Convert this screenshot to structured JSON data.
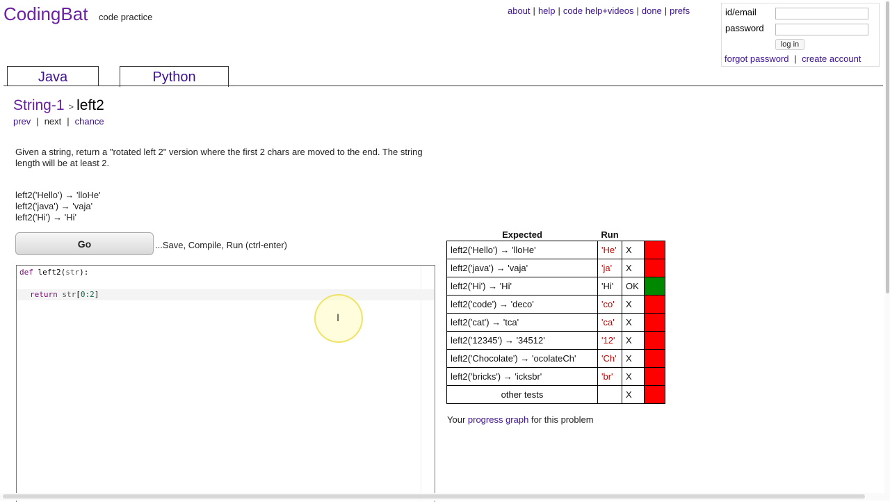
{
  "header": {
    "logo": "CodingBat",
    "tagline": "code practice",
    "nav": [
      {
        "label": "about"
      },
      {
        "label": "help"
      },
      {
        "label": "code help+videos"
      },
      {
        "label": "done"
      },
      {
        "label": "prefs"
      }
    ]
  },
  "login": {
    "id_label": "id/email",
    "password_label": "password",
    "id_value": "",
    "password_value": "",
    "login_button": "log in",
    "forgot_password": "forgot password",
    "separator": "|",
    "create_account": "create account"
  },
  "tabs": [
    {
      "label": "Java",
      "active": false
    },
    {
      "label": "Python",
      "active": true
    }
  ],
  "problem": {
    "category": "String-1",
    "breadcrumb_sep": ">",
    "name": "left2",
    "prev": "prev",
    "next": "next",
    "chance": "chance",
    "description": "Given a string, return a \"rotated left 2\" version where the first 2 chars are moved to the end. The string length will be at least 2.",
    "examples": [
      "left2('Hello') → 'lloHe'",
      "left2('java') → 'vaja'",
      "left2('Hi') → 'Hi'"
    ],
    "go_button": "Go",
    "go_hint": "...Save, Compile, Run (ctrl-enter)"
  },
  "editor": {
    "line1": {
      "kw": "def",
      "fn": "left2",
      "open": "(",
      "arg": "str",
      "close": "):"
    },
    "line2": {
      "kw": "return",
      "var": "str",
      "open": "[",
      "num": "0:2",
      "close": "]"
    }
  },
  "results": {
    "header_expected": "Expected",
    "header_run": "Run",
    "rows": [
      {
        "expected": "left2('Hello') → 'lloHe'",
        "run": "'He'",
        "result": "X",
        "color": "#ff0000"
      },
      {
        "expected": "left2('java') → 'vaja'",
        "run": "'ja'",
        "result": "X",
        "color": "#ff0000"
      },
      {
        "expected": "left2('Hi') → 'Hi'",
        "run": "'Hi'",
        "result": "OK",
        "color": "#008800"
      },
      {
        "expected": "left2('code') → 'deco'",
        "run": "'co'",
        "result": "X",
        "color": "#ff0000"
      },
      {
        "expected": "left2('cat') → 'tca'",
        "run": "'ca'",
        "result": "X",
        "color": "#ff0000"
      },
      {
        "expected": "left2('12345') → '34512'",
        "run": "'12'",
        "result": "X",
        "color": "#ff0000"
      },
      {
        "expected": "left2('Chocolate') → 'ocolateCh'",
        "run": "'Ch'",
        "result": "X",
        "color": "#ff0000"
      },
      {
        "expected": "left2('bricks') → 'icksbr'",
        "run": "'br'",
        "result": "X",
        "color": "#ff0000"
      }
    ],
    "other_tests": {
      "label": "other tests",
      "run": "",
      "result": "X",
      "color": "#ff0000"
    }
  },
  "progress": {
    "prefix": "Your ",
    "link": "progress graph",
    "suffix": " for this problem"
  }
}
